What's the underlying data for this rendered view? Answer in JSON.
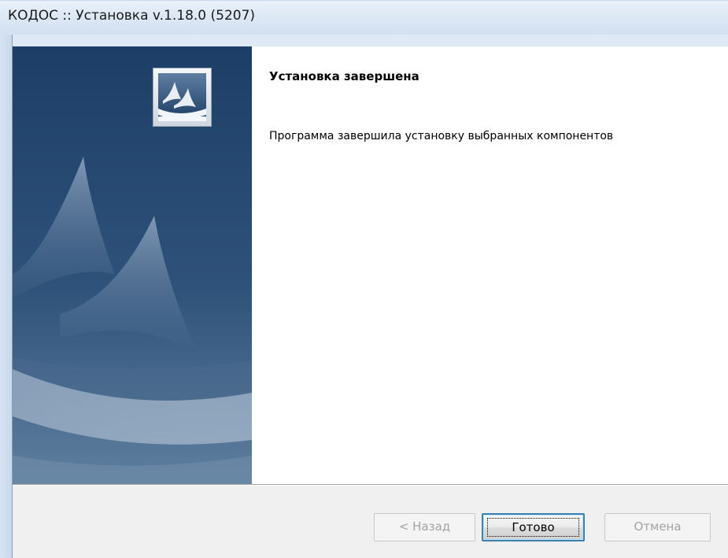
{
  "window": {
    "title": "КОДОС :: Установка v.1.18.0  (5207)"
  },
  "banner": {
    "icon": "setup-logo-icon",
    "colors": {
      "top": "#1d3f67",
      "bottom": "#5f7f9f"
    }
  },
  "page": {
    "heading": "Установка завершена",
    "message": "Программа завершила установку выбранных компонентов"
  },
  "buttons": {
    "back": "< Назад",
    "finish": "Готово",
    "cancel": "Отмена"
  },
  "colors": {
    "titlebar": "#dde8f5",
    "footer": "#f0f0f0",
    "default_button_border": "#3c7fb1",
    "disabled_text": "#a3a3a3"
  }
}
